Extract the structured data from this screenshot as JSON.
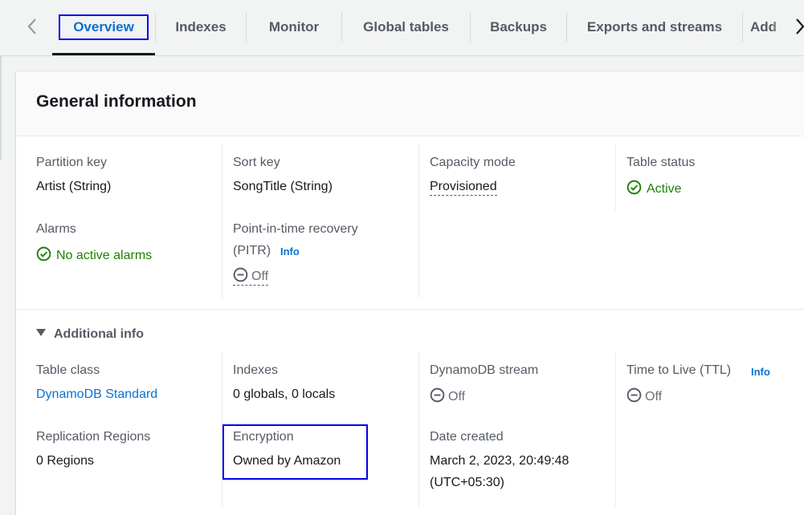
{
  "tabs": [
    {
      "label": "Overview",
      "active": true
    },
    {
      "label": "Indexes"
    },
    {
      "label": "Monitor"
    },
    {
      "label": "Global tables"
    },
    {
      "label": "Backups"
    },
    {
      "label": "Exports and streams"
    },
    {
      "label": "Add"
    }
  ],
  "nav": {
    "prev_icon": "chevron-left-icon",
    "next_icon": "chevron-right-icon"
  },
  "card": {
    "title": "General information"
  },
  "general": {
    "partition_key": {
      "label": "Partition key",
      "value": "Artist (String)"
    },
    "sort_key": {
      "label": "Sort key",
      "value": "SongTitle (String)"
    },
    "capacity_mode": {
      "label": "Capacity mode",
      "value": "Provisioned"
    },
    "table_status": {
      "label": "Table status",
      "value": "Active",
      "icon": "status-check-icon"
    },
    "alarms": {
      "label": "Alarms",
      "value": "No active alarms",
      "icon": "status-check-icon"
    },
    "pitr": {
      "label_line1": "Point-in-time recovery",
      "label_line2": "(PITR)",
      "info": "Info",
      "value": "Off",
      "icon": "status-stopped-icon"
    }
  },
  "additional": {
    "toggle_label": "Additional info",
    "table_class": {
      "label": "Table class",
      "value": "DynamoDB Standard"
    },
    "indexes": {
      "label": "Indexes",
      "value": "0 globals, 0 locals"
    },
    "stream": {
      "label": "DynamoDB stream",
      "value": "Off",
      "icon": "status-stopped-icon"
    },
    "ttl": {
      "label": "Time to Live (TTL)",
      "info": "Info",
      "value": "Off",
      "icon": "status-stopped-icon"
    },
    "replication": {
      "label": "Replication Regions",
      "value": "0 Regions"
    },
    "encryption": {
      "label": "Encryption",
      "value": "Owned by Amazon"
    },
    "date_created": {
      "label": "Date created",
      "value_line1": "March 2, 2023, 20:49:48",
      "value_line2": "(UTC+05:30)"
    }
  },
  "colors": {
    "link": "#0972d3",
    "success": "#1d8102",
    "focus": "#0000ee",
    "text": "#16191f",
    "label": "#545b64"
  }
}
